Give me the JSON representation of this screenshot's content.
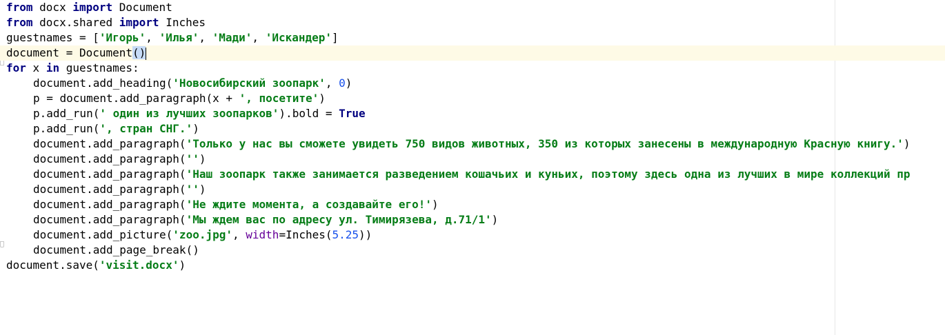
{
  "editor": {
    "language": "python",
    "current_line": 4,
    "lines": [
      {
        "parts": [
          {
            "t": "from",
            "k": "kw"
          },
          {
            "t": " docx ",
            "k": "plain"
          },
          {
            "t": "import",
            "k": "kw"
          },
          {
            "t": " Document",
            "k": "plain"
          }
        ]
      },
      {
        "parts": [
          {
            "t": "from",
            "k": "kw"
          },
          {
            "t": " docx.shared ",
            "k": "plain"
          },
          {
            "t": "import",
            "k": "kw"
          },
          {
            "t": " Inches",
            "k": "plain"
          }
        ]
      },
      {
        "parts": [
          {
            "t": "guestnames = [",
            "k": "plain"
          },
          {
            "t": "'Игорь'",
            "k": "str"
          },
          {
            "t": ", ",
            "k": "plain"
          },
          {
            "t": "'Илья'",
            "k": "str"
          },
          {
            "t": ", ",
            "k": "plain"
          },
          {
            "t": "'Мади'",
            "k": "str"
          },
          {
            "t": ", ",
            "k": "plain"
          },
          {
            "t": "'Искандер'",
            "k": "str"
          },
          {
            "t": "]",
            "k": "plain"
          }
        ]
      },
      {
        "parts": [
          {
            "t": "document = Document",
            "k": "plain"
          },
          {
            "t": "()",
            "k": "brace"
          }
        ],
        "caret": true
      },
      {
        "parts": [
          {
            "t": "for",
            "k": "kw"
          },
          {
            "t": " x ",
            "k": "plain"
          },
          {
            "t": "in",
            "k": "kw"
          },
          {
            "t": " guestnames:",
            "k": "plain"
          }
        ]
      },
      {
        "indent": 1,
        "parts": [
          {
            "t": "document.add_heading(",
            "k": "plain"
          },
          {
            "t": "'Новосибирский зоопарк'",
            "k": "str"
          },
          {
            "t": ", ",
            "k": "plain"
          },
          {
            "t": "0",
            "k": "num"
          },
          {
            "t": ")",
            "k": "plain"
          }
        ]
      },
      {
        "indent": 1,
        "parts": [
          {
            "t": "p = document.add_paragraph(x + ",
            "k": "plain"
          },
          {
            "t": "', посетите'",
            "k": "str"
          },
          {
            "t": ")",
            "k": "plain"
          }
        ]
      },
      {
        "indent": 1,
        "parts": [
          {
            "t": "p.add_run(",
            "k": "plain"
          },
          {
            "t": "' один из лучших зоопарков'",
            "k": "str"
          },
          {
            "t": ").bold = ",
            "k": "plain"
          },
          {
            "t": "True",
            "k": "kw"
          }
        ]
      },
      {
        "indent": 1,
        "parts": [
          {
            "t": "p.add_run(",
            "k": "plain"
          },
          {
            "t": "', стран СНГ.'",
            "k": "str"
          },
          {
            "t": ")",
            "k": "plain"
          }
        ]
      },
      {
        "indent": 1,
        "parts": [
          {
            "t": "document.add_paragraph(",
            "k": "plain"
          },
          {
            "t": "'Только у нас вы сможете увидеть 750 видов животных, 350 из которых занесены в международную Красную книгу.'",
            "k": "str"
          },
          {
            "t": ")",
            "k": "plain"
          }
        ]
      },
      {
        "indent": 1,
        "parts": [
          {
            "t": "document.add_paragraph(",
            "k": "plain"
          },
          {
            "t": "''",
            "k": "str"
          },
          {
            "t": ")",
            "k": "plain"
          }
        ]
      },
      {
        "indent": 1,
        "parts": [
          {
            "t": "document.add_paragraph(",
            "k": "plain"
          },
          {
            "t": "'Наш зоопарк также занимается разведением кошачьих и куньих, поэтому здесь одна из лучших в мире коллекций пр",
            "k": "str"
          }
        ]
      },
      {
        "indent": 1,
        "parts": [
          {
            "t": "document.add_paragraph(",
            "k": "plain"
          },
          {
            "t": "''",
            "k": "str"
          },
          {
            "t": ")",
            "k": "plain"
          }
        ]
      },
      {
        "indent": 1,
        "parts": [
          {
            "t": "document.add_paragraph(",
            "k": "plain"
          },
          {
            "t": "'Не ждите момента, а создавайте его!'",
            "k": "str"
          },
          {
            "t": ")",
            "k": "plain"
          }
        ]
      },
      {
        "indent": 1,
        "parts": [
          {
            "t": "document.add_paragraph(",
            "k": "plain"
          },
          {
            "t": "'Мы ждем вас по адресу ул. Тимирязева, д.71/1'",
            "k": "str"
          },
          {
            "t": ")",
            "k": "plain"
          }
        ]
      },
      {
        "indent": 1,
        "parts": [
          {
            "t": "document.add_picture(",
            "k": "plain"
          },
          {
            "t": "'zoo.jpg'",
            "k": "str"
          },
          {
            "t": ", ",
            "k": "plain"
          },
          {
            "t": "width",
            "k": "kwarg"
          },
          {
            "t": "=Inches(",
            "k": "plain"
          },
          {
            "t": "5.25",
            "k": "num"
          },
          {
            "t": "))",
            "k": "plain"
          }
        ]
      },
      {
        "indent": 1,
        "parts": [
          {
            "t": "document.add_page_break()",
            "k": "plain"
          }
        ]
      },
      {
        "parts": [
          {
            "t": "document.save(",
            "k": "plain"
          },
          {
            "t": "'visit.docx'",
            "k": "str"
          },
          {
            "t": ")",
            "k": "plain"
          }
        ]
      }
    ]
  },
  "colors": {
    "keyword": "#000080",
    "string": "#067d17",
    "number": "#1750eb",
    "kwarg": "#660099",
    "current_line_bg": "#fefae6",
    "brace_match_bg": "#c6dbf7"
  }
}
